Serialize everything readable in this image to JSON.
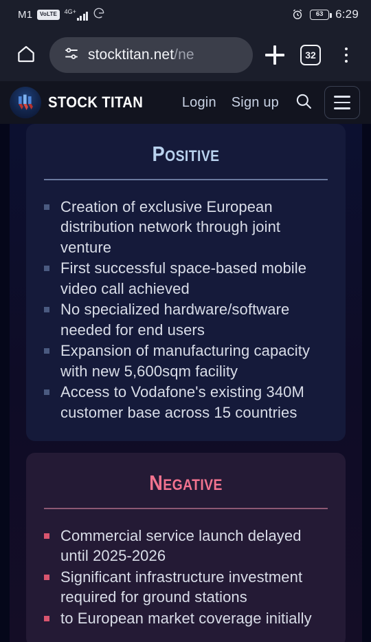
{
  "status_bar": {
    "carrier": "M1",
    "volte_badge": "VoLTE",
    "network_type": "4G+",
    "google_icon": "G",
    "alarm_icon": "alarm-clock-icon",
    "battery_percent": "63",
    "time": "6:29"
  },
  "browser": {
    "home_icon": "home-icon",
    "site_settings_icon": "tune-icon",
    "url_main": "stocktitan.net",
    "url_path": "/ne",
    "new_tab_icon": "plus-icon",
    "tab_count": "32",
    "menu_icon": "kebab-menu-icon"
  },
  "site_header": {
    "logo_icon": "stock-titan-logo",
    "brand": "STOCK TITAN",
    "login_label": "Login",
    "signup_label": "Sign up",
    "search_icon": "search-icon",
    "menu_icon": "hamburger-icon"
  },
  "content": {
    "cards": [
      {
        "id": "positive",
        "title": "Positive",
        "accent": "#b9d2ee",
        "bullet_color": "#4a5a80",
        "items": [
          "Creation of exclusive European distribution network through joint venture",
          "First successful space-based mobile video call achieved",
          "No specialized hardware/software needed for end users",
          "Expansion of manufacturing capacity with new 5,600sqm facility",
          "Access to Vodafone's existing 340M customer base across 15 countries"
        ]
      },
      {
        "id": "negative",
        "title": "Negative",
        "accent": "#f2738f",
        "bullet_color": "#d9556f",
        "items": [
          "Commercial service launch delayed until 2025-2026",
          "Significant infrastructure investment required for ground stations",
          "to European market coverage initially"
        ]
      }
    ]
  }
}
